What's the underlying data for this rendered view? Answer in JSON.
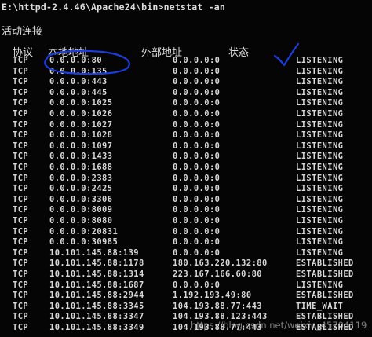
{
  "terminal": {
    "command_line": "E:\\httpd-2.4.46\\Apache24\\bin>netstat -an",
    "section_title": "活动连接",
    "headers": {
      "protocol": "协议",
      "local_address": "本地地址",
      "foreign_address": "外部地址",
      "state": "状态"
    },
    "rows": [
      {
        "proto": "TCP",
        "local": "0.0.0.0:80",
        "foreign": "0.0.0.0:0",
        "state": "LISTENING"
      },
      {
        "proto": "TCP",
        "local": "0.0.0.0:135",
        "foreign": "0.0.0.0:0",
        "state": "LISTENING"
      },
      {
        "proto": "TCP",
        "local": "0.0.0.0:443",
        "foreign": "0.0.0.0:0",
        "state": "LISTENING"
      },
      {
        "proto": "TCP",
        "local": "0.0.0.0:445",
        "foreign": "0.0.0.0:0",
        "state": "LISTENING"
      },
      {
        "proto": "TCP",
        "local": "0.0.0.0:1025",
        "foreign": "0.0.0.0:0",
        "state": "LISTENING"
      },
      {
        "proto": "TCP",
        "local": "0.0.0.0:1026",
        "foreign": "0.0.0.0:0",
        "state": "LISTENING"
      },
      {
        "proto": "TCP",
        "local": "0.0.0.0:1027",
        "foreign": "0.0.0.0:0",
        "state": "LISTENING"
      },
      {
        "proto": "TCP",
        "local": "0.0.0.0:1028",
        "foreign": "0.0.0.0:0",
        "state": "LISTENING"
      },
      {
        "proto": "TCP",
        "local": "0.0.0.0:1097",
        "foreign": "0.0.0.0:0",
        "state": "LISTENING"
      },
      {
        "proto": "TCP",
        "local": "0.0.0.0:1433",
        "foreign": "0.0.0.0:0",
        "state": "LISTENING"
      },
      {
        "proto": "TCP",
        "local": "0.0.0.0:1688",
        "foreign": "0.0.0.0:0",
        "state": "LISTENING"
      },
      {
        "proto": "TCP",
        "local": "0.0.0.0:2383",
        "foreign": "0.0.0.0:0",
        "state": "LISTENING"
      },
      {
        "proto": "TCP",
        "local": "0.0.0.0:2425",
        "foreign": "0.0.0.0:0",
        "state": "LISTENING"
      },
      {
        "proto": "TCP",
        "local": "0.0.0.0:3306",
        "foreign": "0.0.0.0:0",
        "state": "LISTENING"
      },
      {
        "proto": "TCP",
        "local": "0.0.0.0:8009",
        "foreign": "0.0.0.0:0",
        "state": "LISTENING"
      },
      {
        "proto": "TCP",
        "local": "0.0.0.0:8080",
        "foreign": "0.0.0.0:0",
        "state": "LISTENING"
      },
      {
        "proto": "TCP",
        "local": "0.0.0.0:20831",
        "foreign": "0.0.0.0:0",
        "state": "LISTENING"
      },
      {
        "proto": "TCP",
        "local": "0.0.0.0:30985",
        "foreign": "0.0.0.0:0",
        "state": "LISTENING"
      },
      {
        "proto": "TCP",
        "local": "10.101.145.88:139",
        "foreign": "0.0.0.0:0",
        "state": "LISTENING"
      },
      {
        "proto": "TCP",
        "local": "10.101.145.88:1178",
        "foreign": "180.163.220.132:80",
        "state": "ESTABLISHED"
      },
      {
        "proto": "TCP",
        "local": "10.101.145.88:1314",
        "foreign": "223.167.166.60:80",
        "state": "ESTABLISHED"
      },
      {
        "proto": "TCP",
        "local": "10.101.145.88:1687",
        "foreign": "0.0.0.0:0",
        "state": "LISTENING"
      },
      {
        "proto": "TCP",
        "local": "10.101.145.88:2944",
        "foreign": "1.192.193.49:80",
        "state": "ESTABLISHED"
      },
      {
        "proto": "TCP",
        "local": "10.101.145.88:3345",
        "foreign": "104.193.88.77:443",
        "state": "TIME_WAIT"
      },
      {
        "proto": "TCP",
        "local": "10.101.145.88:3347",
        "foreign": "104.193.88.123:443",
        "state": "ESTABLISHED"
      },
      {
        "proto": "TCP",
        "local": "10.101.145.88:3349",
        "foreign": "104.193.88.77:443",
        "state": "ESTABLISHED"
      }
    ]
  },
  "annotations": {
    "stroke_color": "#1a3de0",
    "circle_target": "0.0.0.0:80",
    "checkmark_target": "LISTENING"
  },
  "watermark": {
    "text": "https://blog.csdn.net/weixin_45704119"
  }
}
